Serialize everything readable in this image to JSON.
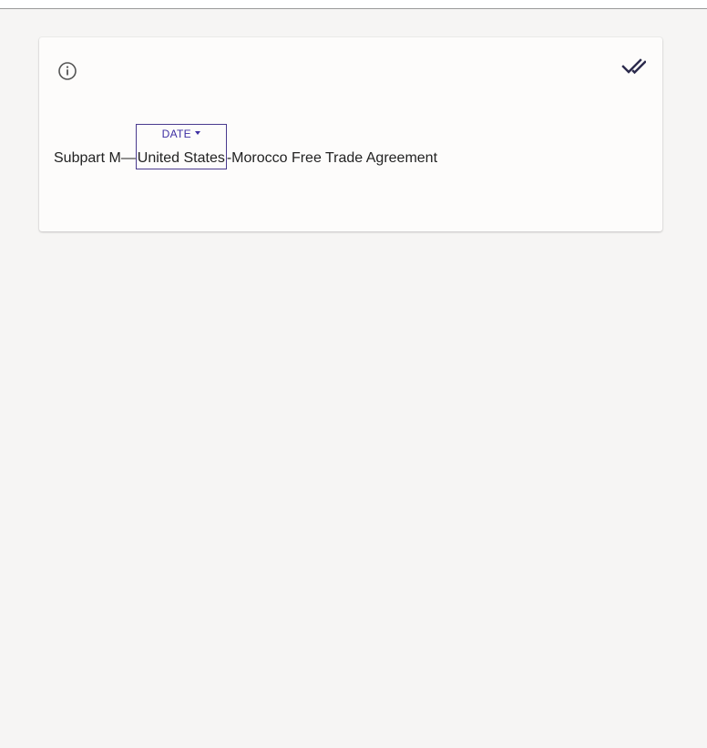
{
  "card": {
    "icons": {
      "info": "info-circle-icon",
      "confirm": "double-check-icon"
    },
    "text": {
      "before": "Subpart M—",
      "entity": {
        "tag": "DATE",
        "text": "United States"
      },
      "after": "-Morocco Free Trade Agreement"
    }
  },
  "colors": {
    "background": "#f6f5f4",
    "card": "#fdfcfb",
    "accent": "#3e2fa3",
    "entity_border": "#4a3a8e",
    "icon_dark": "#2b2a4c",
    "icon_gray": "#555555"
  }
}
